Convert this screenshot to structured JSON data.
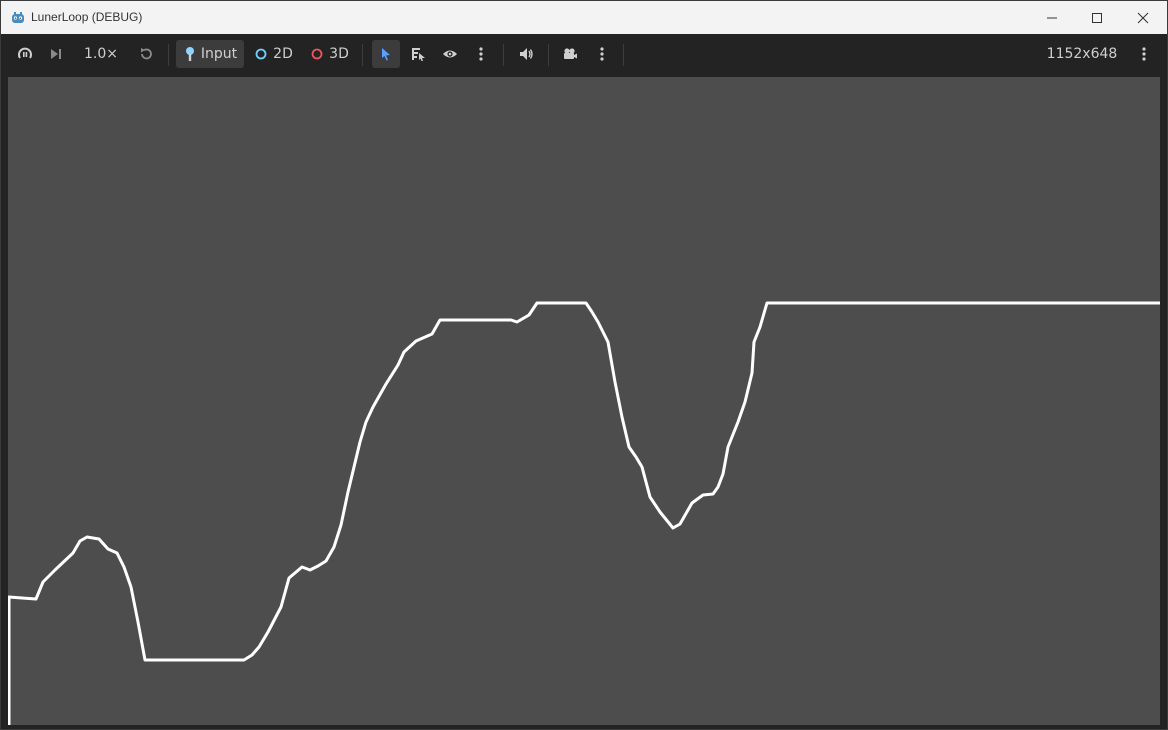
{
  "window": {
    "title": "LunerLoop (DEBUG)"
  },
  "toolbar": {
    "speed_label": "1.0×",
    "input_label": "Input",
    "mode_2d_label": "2D",
    "mode_3d_label": "3D",
    "resolution_label": "1152x648",
    "colors": {
      "mode_2d_ring": "#6fd0ff",
      "mode_3d_ring": "#e8565f",
      "select_arrow": "#5aa0ff"
    }
  },
  "viewport": {
    "background": "#4d4d4d",
    "line_color": "#ffffff"
  }
}
